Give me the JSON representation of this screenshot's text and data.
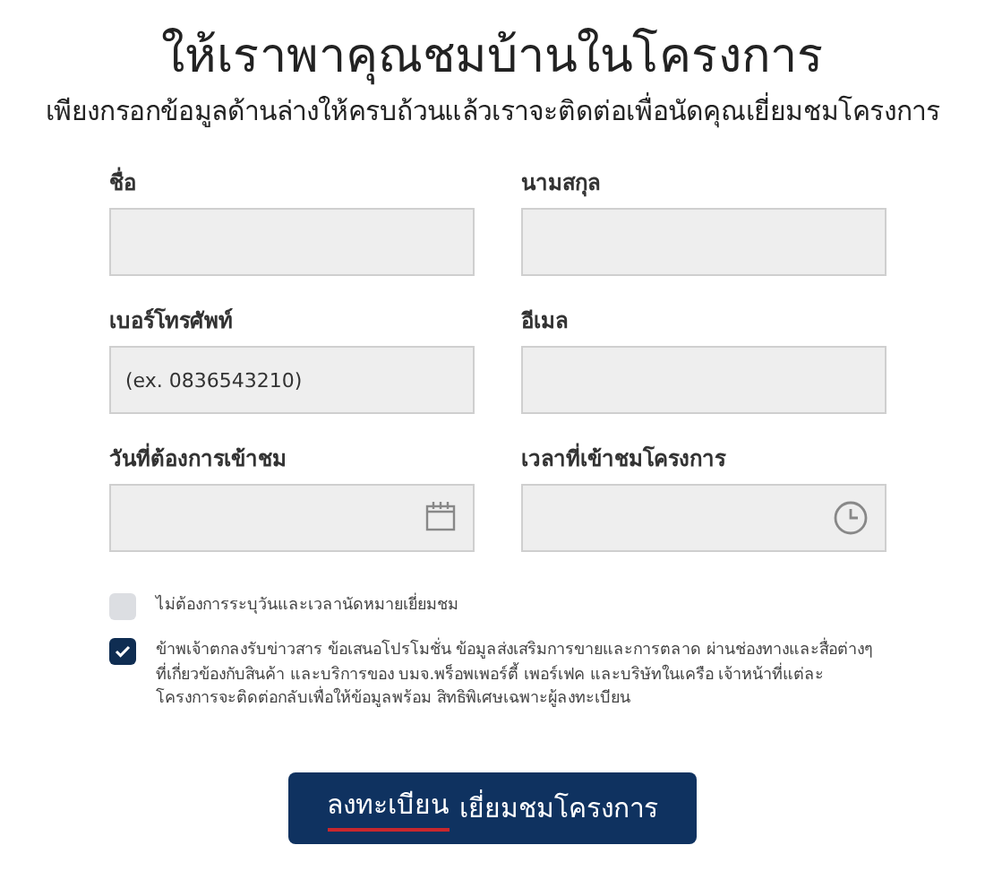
{
  "title": "ให้เราพาคุณชมบ้านในโครงการ",
  "subtitle": "เพียงกรอกข้อมูลด้านล่างให้ครบถ้วนแล้วเราจะติดต่อเพื่อนัดคุณเยี่ยมชมโครงการ",
  "fields": [
    {
      "label": "ชื่อ",
      "kind": "text"
    },
    {
      "label": "นามสกุล",
      "kind": "text"
    },
    {
      "label": "เบอร์โทรศัพท์",
      "kind": "text",
      "placeholder": "(ex. 0836543210)"
    },
    {
      "label": "อีเมล",
      "kind": "text"
    },
    {
      "label": "วันที่ต้องการเข้าชม",
      "kind": "date"
    },
    {
      "label": "เวลาที่เข้าชมโครงการ",
      "kind": "time"
    }
  ],
  "checkboxes": [
    {
      "label": "ไม่ต้องการระบุวันและเวลานัดหมายเยี่ยมชม",
      "checked": false
    },
    {
      "label": "ข้าพเจ้าตกลงรับข่าวสาร ข้อเสนอโปรโมชั่น ข้อมูลส่งเสริมการขายและการตลาด ผ่านช่องทางและสื่อต่างๆ ที่เกี่ยวข้องกับสินค้า และบริการของ บมจ.พร็อพเพอร์ตี้ เพอร์เฟค และบริษัทในเครือ เจ้าหน้าที่แต่ละโครงการจะติดต่อกลับเพื่อให้ข้อมูลพร้อม สิทธิพิเศษเฉพาะผู้ลงทะเบียน",
      "checked": true
    }
  ],
  "submit": {
    "emphasis": "ลงทะเบียน",
    "text": "เยี่ยมชมโครงการ"
  }
}
